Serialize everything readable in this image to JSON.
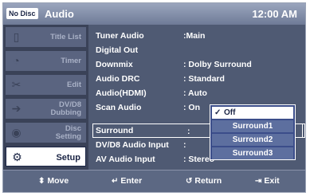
{
  "header": {
    "badge": "No Disc",
    "title": "Audio",
    "clock": "12:00 AM"
  },
  "sidebar": {
    "items": [
      {
        "label_lines": [
          "Title List"
        ],
        "icon": "film-icon",
        "glyph": "▯"
      },
      {
        "label_lines": [
          "Timer"
        ],
        "icon": "clock-icon",
        "glyph": "◔"
      },
      {
        "label_lines": [
          "Edit"
        ],
        "icon": "scissors-icon",
        "glyph": "✂"
      },
      {
        "label_lines": [
          "DV/D8",
          "Dubbing"
        ],
        "icon": "dubbing-icon",
        "glyph": "➔"
      },
      {
        "label_lines": [
          "Disc",
          "Setting"
        ],
        "icon": "disc-icon",
        "glyph": "◉"
      },
      {
        "label_lines": [
          "Setup"
        ],
        "icon": "gear-icon",
        "glyph": "⚙",
        "active": true
      }
    ]
  },
  "menu": {
    "rows": [
      {
        "name": "Tuner Audio",
        "value": ":Main"
      },
      {
        "name": "Digital Out",
        "value": ""
      },
      {
        "name": "Downmix",
        "value": ": Dolby Surround"
      },
      {
        "name": "Audio DRC",
        "value": ": Standard"
      },
      {
        "name": "Audio(HDMI)",
        "value": ": Auto"
      },
      {
        "name": "Scan Audio",
        "value": ": On"
      },
      {
        "name": "Surround",
        "value": ":",
        "selected": true
      },
      {
        "name": "DV/D8 Audio Input",
        "value": ":"
      },
      {
        "name": "AV Audio Input",
        "value": ": Stereo"
      }
    ]
  },
  "popup": {
    "options": [
      {
        "label": "Off",
        "checked": true
      },
      {
        "label": "Surround1"
      },
      {
        "label": "Surround2"
      },
      {
        "label": "Surround3"
      }
    ]
  },
  "footer": {
    "move": {
      "icon": "updown-arrow-icon",
      "glyph": "⬍",
      "label": "Move"
    },
    "enter": {
      "icon": "enter-icon",
      "glyph": "↵",
      "label": "Enter"
    },
    "return": {
      "icon": "return-icon",
      "glyph": "↺",
      "label": "Return"
    },
    "exit": {
      "icon": "exit-icon",
      "glyph": "⇥",
      "label": "Exit"
    }
  }
}
